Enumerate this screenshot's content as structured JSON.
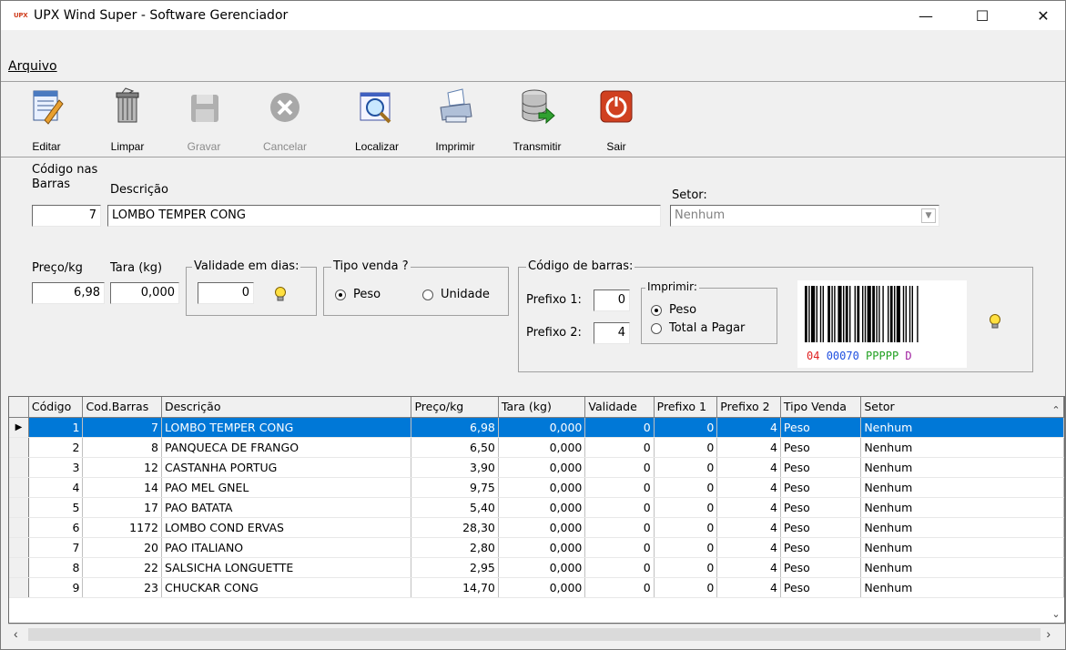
{
  "window": {
    "app_logo": "UPX",
    "title": "UPX Wind Super - Software Gerenciador",
    "minimize": "—",
    "maximize": "☐",
    "close": "✕"
  },
  "menu": {
    "arquivo": "Arquivo"
  },
  "toolbar": [
    {
      "name": "editar",
      "label": "Editar",
      "icon": "edit-icon",
      "enabled": true
    },
    {
      "name": "limpar",
      "label": "Limpar",
      "icon": "trash-icon",
      "enabled": true
    },
    {
      "name": "gravar",
      "label": "Gravar",
      "icon": "save-icon",
      "enabled": false
    },
    {
      "name": "cancelar",
      "label": "Cancelar",
      "icon": "cancel-icon",
      "enabled": false
    },
    {
      "name": "localizar",
      "label": "Localizar",
      "icon": "search-icon",
      "enabled": true
    },
    {
      "name": "imprimir",
      "label": "Imprimir",
      "icon": "printer-icon",
      "enabled": true
    },
    {
      "name": "transmitir",
      "label": "Transmitir",
      "icon": "database-transmit-icon",
      "enabled": true
    },
    {
      "name": "sair",
      "label": "Sair",
      "icon": "power-icon",
      "enabled": true
    }
  ],
  "form": {
    "codigo_label_line1": "Código nas",
    "codigo_label_line2": "Barras",
    "codigo_value": "7",
    "descricao_label": "Descrição",
    "descricao_value": "LOMBO TEMPER CONG",
    "setor_label": "Setor:",
    "setor_value": "Nenhum",
    "preco_label": "Preço/kg",
    "preco_value": "6,98",
    "tara_label": "Tara (kg)",
    "tara_value": "0,000",
    "validade_label": "Validade em dias:",
    "validade_value": "0",
    "tipo_venda_label": "Tipo venda ?",
    "tipo_peso": "Peso",
    "tipo_unidade": "Unidade",
    "tipo_selected": "Peso",
    "codigo_barras_label": "Código de barras:",
    "prefixo1_label": "Prefixo 1:",
    "prefixo1_value": "0",
    "prefixo2_label": "Prefixo 2:",
    "prefixo2_value": "4",
    "imprimir_label": "Imprimir:",
    "imprimir_peso": "Peso",
    "imprimir_total": "Total a Pagar",
    "imprimir_selected": "Peso",
    "barcode_part1": "04",
    "barcode_part2": "00070",
    "barcode_part3": "PPPPP",
    "barcode_part4": "D"
  },
  "grid": {
    "columns": [
      "Código",
      "Cod.Barras",
      "Descrição",
      "Preço/kg",
      "Tara (kg)",
      "Validade",
      "Prefixo 1",
      "Prefixo 2",
      "Tipo Venda",
      "Setor"
    ],
    "selected_row": 0,
    "rows": [
      [
        "1",
        "7",
        "LOMBO TEMPER CONG",
        "6,98",
        "0,000",
        "0",
        "0",
        "4",
        "Peso",
        "Nenhum"
      ],
      [
        "2",
        "8",
        "PANQUECA DE FRANGO",
        "6,50",
        "0,000",
        "0",
        "0",
        "4",
        "Peso",
        "Nenhum"
      ],
      [
        "3",
        "12",
        "CASTANHA PORTUG",
        "3,90",
        "0,000",
        "0",
        "0",
        "4",
        "Peso",
        "Nenhum"
      ],
      [
        "4",
        "14",
        "PAO MEL GNEL",
        "9,75",
        "0,000",
        "0",
        "0",
        "4",
        "Peso",
        "Nenhum"
      ],
      [
        "5",
        "17",
        "PAO BATATA",
        "5,40",
        "0,000",
        "0",
        "0",
        "4",
        "Peso",
        "Nenhum"
      ],
      [
        "6",
        "1172",
        "LOMBO COND ERVAS",
        "28,30",
        "0,000",
        "0",
        "0",
        "4",
        "Peso",
        "Nenhum"
      ],
      [
        "7",
        "20",
        "PAO ITALIANO",
        "2,80",
        "0,000",
        "0",
        "0",
        "4",
        "Peso",
        "Nenhum"
      ],
      [
        "8",
        "22",
        "SALSICHA LONGUETTE",
        "2,95",
        "0,000",
        "0",
        "0",
        "4",
        "Peso",
        "Nenhum"
      ],
      [
        "9",
        "23",
        "CHUCKAR CONG",
        "14,70",
        "0,000",
        "0",
        "0",
        "4",
        "Peso",
        "Nenhum"
      ]
    ]
  },
  "colors": {
    "selection": "#0078d7",
    "barcode_part1": "#e02020",
    "barcode_part2": "#2050e0",
    "barcode_part3": "#20a020",
    "barcode_part4": "#a020a0"
  }
}
